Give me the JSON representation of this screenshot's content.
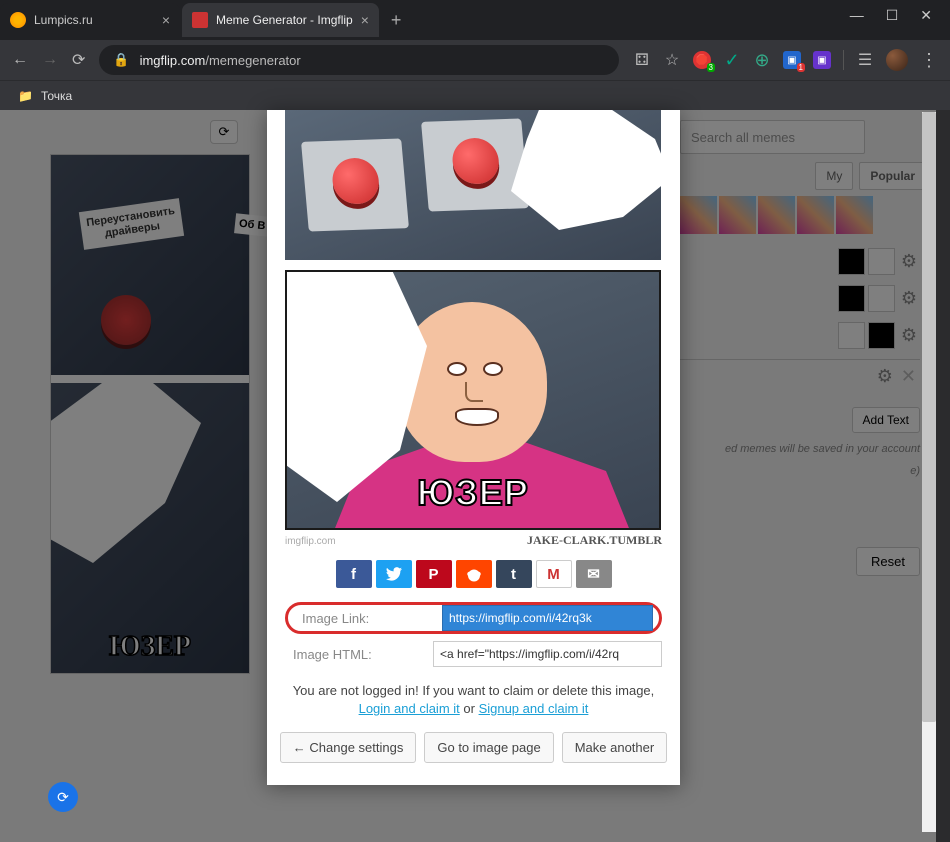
{
  "tabs": {
    "t1": "Lumpics.ru",
    "t2": "Meme Generator - Imgflip"
  },
  "url": {
    "host": "imgflip.com",
    "path": "/memegenerator"
  },
  "bookmarks": {
    "item1": "Точка"
  },
  "bg": {
    "label1": "Переустановить\nдрайверы",
    "label2": "Об\nВ",
    "user": "ЮЗЕР",
    "search_ph": "Search all memes",
    "my": "My",
    "popular": "Popular",
    "addtext": "Add Text",
    "note": "ed memes will be saved in your account",
    "note2": "e)",
    "reset": "Reset"
  },
  "modal": {
    "user": "ЮЗЕР",
    "credit": "JAKE-CLARK.TUMBLR",
    "wm": "imgflip.com",
    "link_label": "Image Link:",
    "link_val": "https://imgflip.com/i/42rq3k",
    "html_label": "Image HTML:",
    "html_val": "<a href=\"https://imgflip.com/i/42rq",
    "login1": "You are not logged in! If you want to claim or delete this image, ",
    "login2": "Login and claim it",
    "login3": " or ",
    "login4": "Signup and claim it",
    "btn1": "← Change settings",
    "btn2": "Go to image page",
    "btn3": "Make another"
  },
  "share": {
    "fb": "f",
    "tw": "🐦",
    "pn": "P",
    "rd": "👽",
    "tm": "t",
    "gm": "M",
    "em": "✉"
  },
  "win": {
    "min": "—",
    "max": "☐",
    "close": "✕"
  }
}
